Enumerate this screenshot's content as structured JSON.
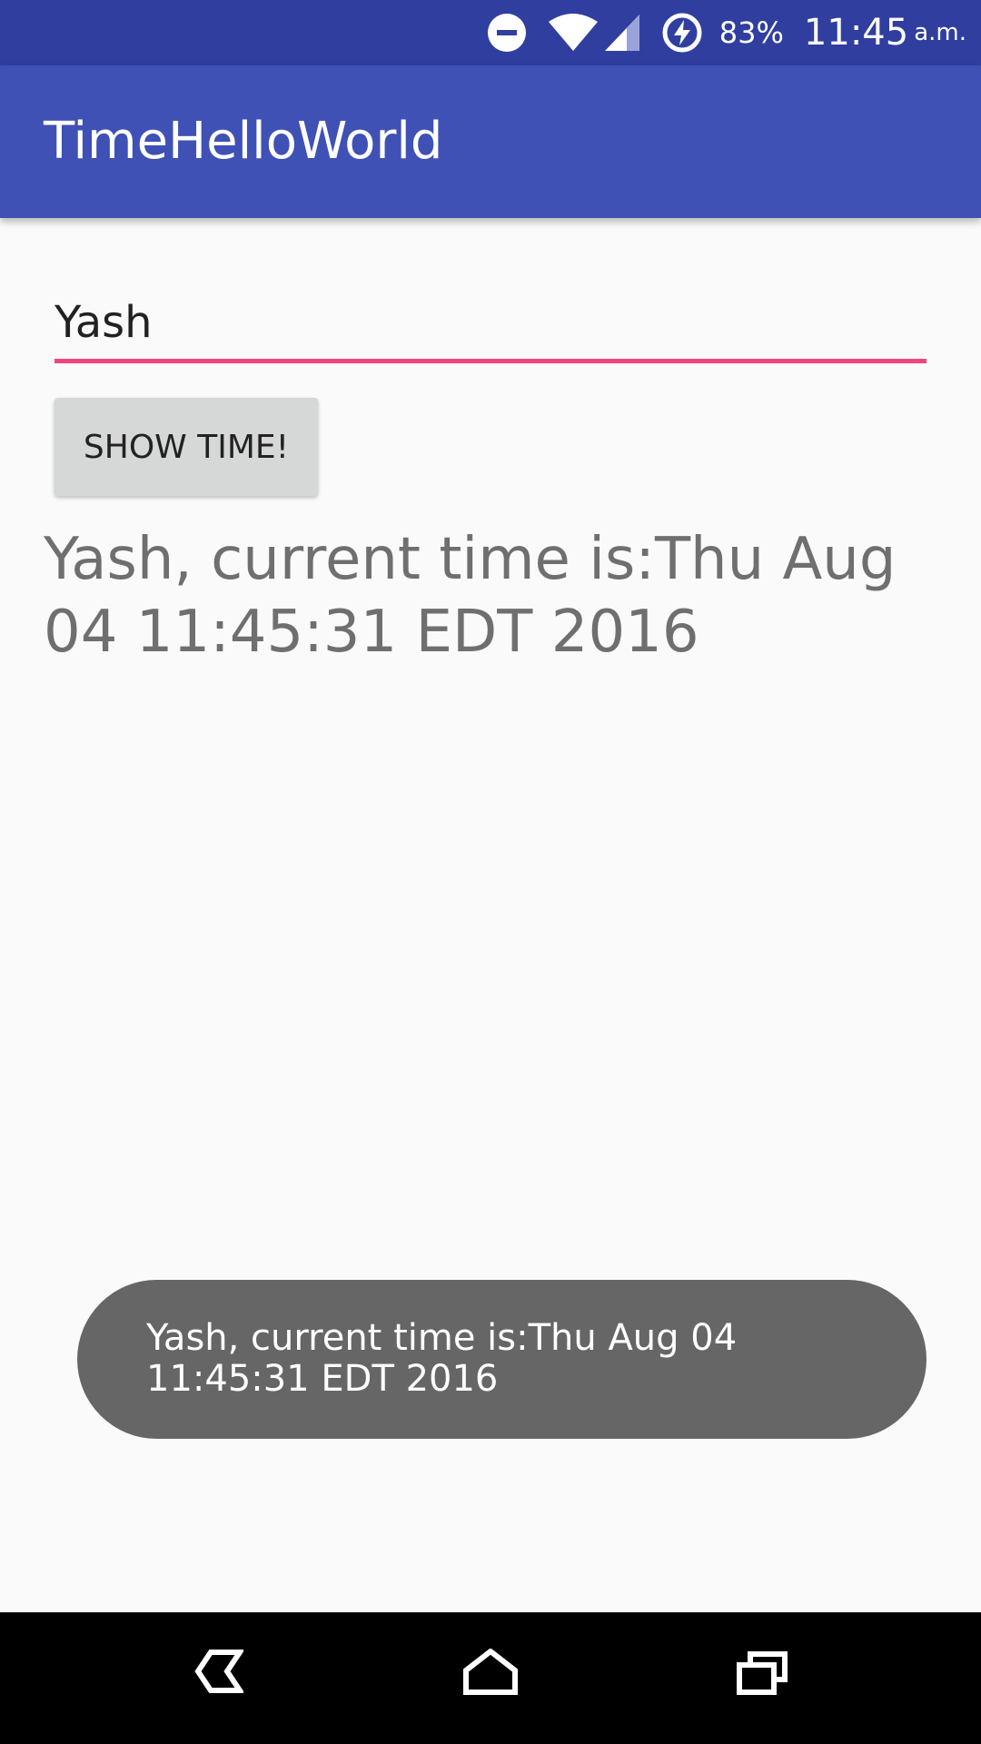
{
  "status_bar": {
    "battery_percent": "83%",
    "time": "11:45",
    "time_suffix": "a.m.",
    "icons": [
      "do-not-disturb-icon",
      "wifi-icon",
      "cell-signal-icon",
      "battery-charging-icon"
    ]
  },
  "app_bar": {
    "title": "TimeHelloWorld",
    "color": "#3f51b5",
    "status_color": "#303f9f"
  },
  "name_input": {
    "value": "Yash",
    "underline_color": "#f0467c"
  },
  "show_button": {
    "label": "SHOW TIME!"
  },
  "result": {
    "text": "Yash, current time is:Thu Aug 04 11:45:31 EDT 2016"
  },
  "toast": {
    "text": "Yash, current time is:Thu Aug 04 11:45:31 EDT 2016"
  },
  "nav_bar": {
    "buttons": [
      "back-icon",
      "home-icon",
      "recents-icon"
    ]
  }
}
